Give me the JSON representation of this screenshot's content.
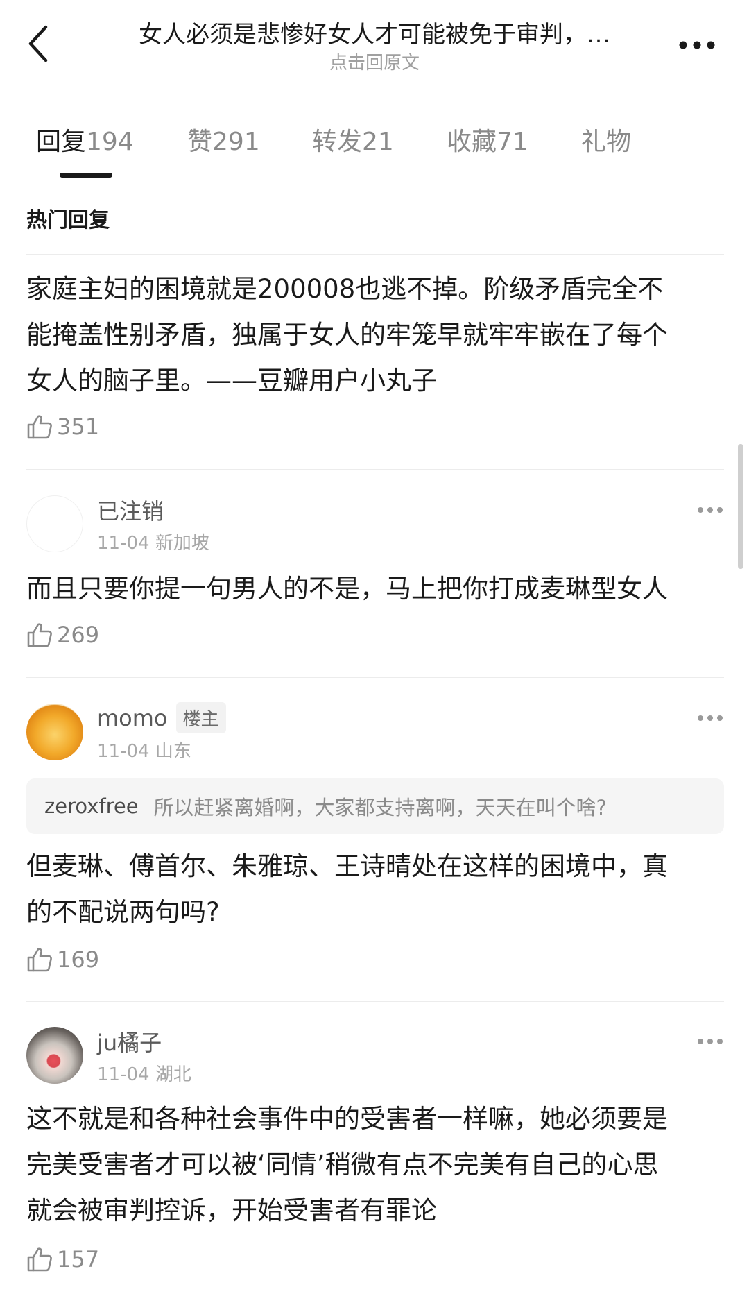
{
  "header": {
    "title": "女人必须是悲惨好女人才可能被免于审判，…",
    "subtitle": "点击回原文"
  },
  "tabs": [
    {
      "label": "回复",
      "count": "194"
    },
    {
      "label": "赞",
      "count": "291"
    },
    {
      "label": "转发",
      "count": "21"
    },
    {
      "label": "收藏",
      "count": "71"
    },
    {
      "label": "礼物",
      "count": ""
    }
  ],
  "section_title": "热门回复",
  "post": {
    "lines": [
      "家庭主妇的困境就是200008也逃不掉。阶级矛盾完全不",
      "能掩盖性别矛盾，独属于女人的牢笼早就牢牢嵌在了每个",
      "女人的脑子里。——豆瓣用户小丸子"
    ],
    "likes": "351"
  },
  "comments": [
    {
      "username": "已注销",
      "badge": "",
      "date": "11-04",
      "location": "新加坡",
      "lines": [
        "而且只要你提一句男人的不是，马上把你打成麦琳型女人"
      ],
      "likes": "269"
    },
    {
      "username": "momo",
      "badge": "楼主",
      "date": "11-04",
      "location": "山东",
      "quote_user": "zeroxfree",
      "quote_text": "所以赶紧离婚啊，大家都支持离啊，天天在叫个啥?",
      "lines": [
        "但麦琳、傅首尔、朱雅琼、王诗晴处在这样的困境中，真",
        "的不配说两句吗?"
      ],
      "likes": "169"
    },
    {
      "username": "ju橘子",
      "badge": "",
      "date": "11-04",
      "location": "湖北",
      "lines": [
        "这不就是和各种社会事件中的受害者一样嘛，她必须要是",
        "完美受害者才可以被‘同情’稍微有点不完美有自己的心思",
        "就会被审判控诉，开始受害者有罪论"
      ],
      "likes": "157"
    }
  ],
  "icons": {
    "back": "chevron-left-icon",
    "more": "more-dots-icon",
    "like": "thumbs-up-icon"
  },
  "colors": {
    "text_primary": "#1a1a1a",
    "text_secondary": "#8a8a8a",
    "quote_bg": "#f5f5f5"
  }
}
